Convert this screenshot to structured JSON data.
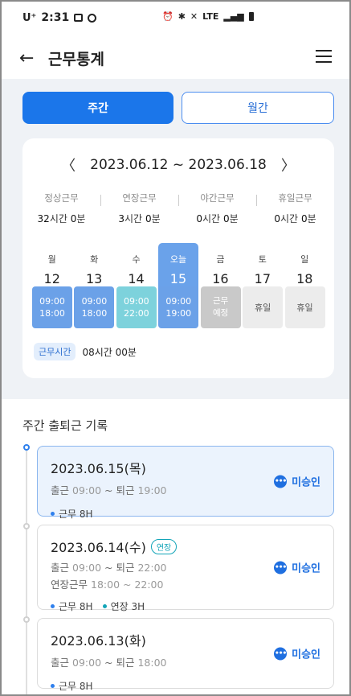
{
  "status_bar": {
    "carrier": "U⁺",
    "time": "2:31",
    "signal": "LTE"
  },
  "header": {
    "title": "근무통계"
  },
  "tabs": [
    {
      "label": "주간",
      "active": true
    },
    {
      "label": "월간",
      "active": false
    }
  ],
  "week": {
    "range": "2023.06.12 ~ 2023.06.18",
    "summary": [
      {
        "label": "정상근무",
        "hours": "32",
        "h_unit": "시간",
        "mins": "0",
        "m_unit": "분"
      },
      {
        "label": "연장근무",
        "hours": "3",
        "h_unit": "시간",
        "mins": "0",
        "m_unit": "분"
      },
      {
        "label": "야간근무",
        "hours": "0",
        "h_unit": "시간",
        "mins": "0",
        "m_unit": "분"
      },
      {
        "label": "휴일근무",
        "hours": "0",
        "h_unit": "시간",
        "mins": "0",
        "m_unit": "분"
      }
    ],
    "days": [
      {
        "name": "월",
        "date": "12",
        "slot1": "09:00",
        "slot2": "18:00",
        "type": "blue"
      },
      {
        "name": "화",
        "date": "13",
        "slot1": "09:00",
        "slot2": "18:00",
        "type": "blue"
      },
      {
        "name": "수",
        "date": "14",
        "slot1": "09:00",
        "slot2": "22:00",
        "type": "cyan"
      },
      {
        "name": "오늘",
        "date": "15",
        "slot1": "09:00",
        "slot2": "19:00",
        "type": "blue"
      },
      {
        "name": "금",
        "date": "16",
        "slot1": "근무",
        "slot2": "예정",
        "type": "gray"
      },
      {
        "name": "토",
        "date": "17",
        "slot1": "휴일",
        "slot2": "",
        "type": "off"
      },
      {
        "name": "일",
        "date": "18",
        "slot1": "휴일",
        "slot2": "",
        "type": "off"
      }
    ],
    "work_time_label": "근무시간",
    "work_time_value": "08시간 00분"
  },
  "records": {
    "title": "주간 출퇴근 기록",
    "items": [
      {
        "date": "2023.06.15(목)",
        "ext": "",
        "in_label": "출근",
        "in": "09:00",
        "sep": "~",
        "out_label": "퇴근",
        "out": "19:00",
        "ot_label": "",
        "ot": "",
        "tag1": "근무 8H",
        "tag2": "",
        "status": "미승인"
      },
      {
        "date": "2023.06.14(수)",
        "ext": "연장",
        "in_label": "출근",
        "in": "09:00",
        "sep": "~",
        "out_label": "퇴근",
        "out": "22:00",
        "ot_label": "연장근무",
        "ot": "18:00 ~ 22:00",
        "tag1": "근무 8H",
        "tag2": "연장 3H",
        "status": "미승인"
      },
      {
        "date": "2023.06.13(화)",
        "ext": "",
        "in_label": "출근",
        "in": "09:00",
        "sep": "~",
        "out_label": "퇴근",
        "out": "18:00",
        "ot_label": "",
        "ot": "",
        "tag1": "근무 8H",
        "tag2": "",
        "status": "미승인"
      }
    ]
  },
  "colors": {
    "primary": "#1b76ea",
    "extension": "#13a5b8",
    "work": "#2f80ed"
  }
}
